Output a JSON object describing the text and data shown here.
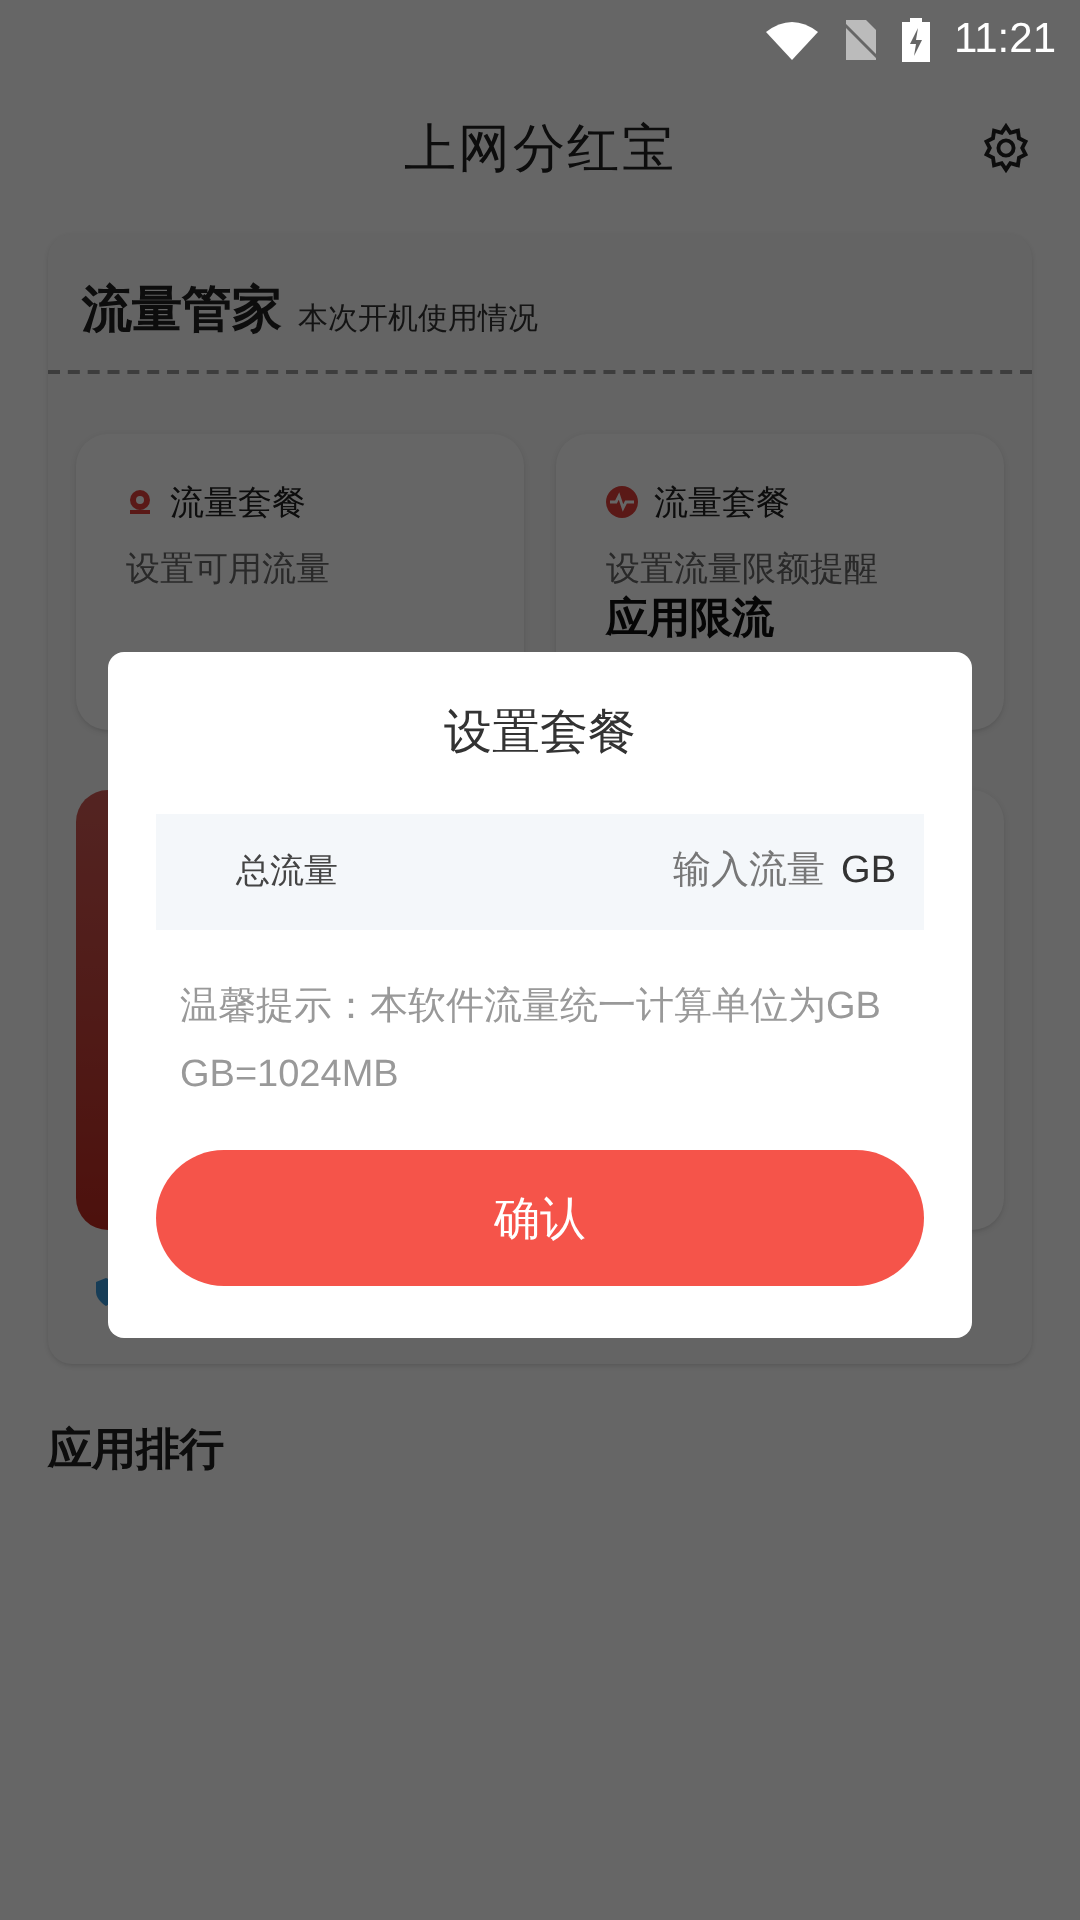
{
  "status_bar": {
    "time": "11:21"
  },
  "app_bar": {
    "title": "上网分红宝"
  },
  "traffic_card": {
    "title": "流量管家",
    "subtitle": "本次开机使用情况",
    "tiles": [
      {
        "title": "流量套餐",
        "desc": "设置可用流量",
        "kind": "plan"
      },
      {
        "title": "流量套餐",
        "desc": "设置流量限额提醒",
        "extra": "应用限流",
        "kind": "pulse"
      }
    ]
  },
  "ranking": {
    "title": "应用排行"
  },
  "dialog": {
    "title": "设置套餐",
    "field": {
      "label": "总流量",
      "placeholder": "输入流量",
      "unit": "GB"
    },
    "hint_lines": [
      "温馨提示：本软件流量统一计算单位为GB",
      "GB=1024MB"
    ],
    "confirm": "确认"
  }
}
